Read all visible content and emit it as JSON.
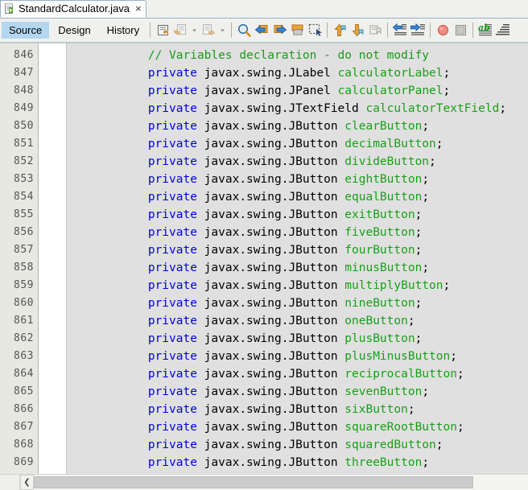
{
  "window": {
    "tab": {
      "title": "StandardCalculator.java",
      "close_label": "×",
      "icon": "java-file-icon"
    }
  },
  "view_tabs": [
    {
      "label": "Source",
      "active": true
    },
    {
      "label": "Design",
      "active": false
    },
    {
      "label": "History",
      "active": false
    }
  ],
  "toolbar": {
    "groups": [
      {
        "name": "navigation",
        "buttons": [
          {
            "name": "last-edit-back-button",
            "icon": "back-document-icon"
          },
          {
            "name": "last-edit-back-dropdown",
            "icon": "chevron-down-icon"
          },
          {
            "name": "last-edit-forward-button",
            "icon": "forward-document-icon"
          },
          {
            "name": "last-edit-forward-dropdown",
            "icon": "chevron-down-icon"
          }
        ]
      },
      {
        "name": "find",
        "buttons": [
          {
            "name": "find-selection-button",
            "icon": "magnifier-icon"
          },
          {
            "name": "find-previous-button",
            "icon": "arrow-left-find-icon"
          },
          {
            "name": "find-next-button",
            "icon": "arrow-right-find-icon"
          },
          {
            "name": "toggle-highlight-button",
            "icon": "highlight-rect-icon"
          },
          {
            "name": "toggle-rectangular-selection-button",
            "icon": "rect-select-icon"
          }
        ]
      },
      {
        "name": "bookmarks",
        "buttons": [
          {
            "name": "previous-bookmark-button",
            "icon": "arrow-up-bookmark-icon"
          },
          {
            "name": "next-bookmark-button",
            "icon": "arrow-down-bookmark-icon"
          },
          {
            "name": "toggle-bookmark-button",
            "icon": "toggle-bookmark-icon"
          }
        ]
      },
      {
        "name": "indent",
        "buttons": [
          {
            "name": "shift-left-button",
            "icon": "shift-left-icon"
          },
          {
            "name": "shift-right-button",
            "icon": "shift-right-icon"
          }
        ]
      },
      {
        "name": "debug",
        "buttons": [
          {
            "name": "toggle-breakpoint-button",
            "icon": "breakpoint-circle-icon"
          },
          {
            "name": "stop-button",
            "icon": "stop-square-icon"
          }
        ]
      },
      {
        "name": "format",
        "buttons": [
          {
            "name": "check-comments-button",
            "icon": "spellcheck-lines-icon"
          },
          {
            "name": "format-button",
            "icon": "format-lines-icon"
          }
        ]
      }
    ]
  },
  "editor": {
    "first_line_number": 846,
    "lines": [
      {
        "number": 846,
        "tokens": [
          {
            "t": "        ",
            "c": "pln"
          },
          {
            "t": "// Variables declaration - do not modify",
            "c": "cmt"
          }
        ]
      },
      {
        "number": 847,
        "tokens": [
          {
            "t": "        ",
            "c": "pln"
          },
          {
            "t": "private",
            "c": "kw"
          },
          {
            "t": " javax.swing.JLabel ",
            "c": "pln"
          },
          {
            "t": "calculatorLabel",
            "c": "fld"
          },
          {
            "t": ";",
            "c": "pln"
          }
        ]
      },
      {
        "number": 848,
        "tokens": [
          {
            "t": "        ",
            "c": "pln"
          },
          {
            "t": "private",
            "c": "kw"
          },
          {
            "t": " javax.swing.JPanel ",
            "c": "pln"
          },
          {
            "t": "calculatorPanel",
            "c": "fld"
          },
          {
            "t": ";",
            "c": "pln"
          }
        ]
      },
      {
        "number": 849,
        "tokens": [
          {
            "t": "        ",
            "c": "pln"
          },
          {
            "t": "private",
            "c": "kw"
          },
          {
            "t": " javax.swing.JTextField ",
            "c": "pln"
          },
          {
            "t": "calculatorTextField",
            "c": "fld"
          },
          {
            "t": ";",
            "c": "pln"
          }
        ]
      },
      {
        "number": 850,
        "tokens": [
          {
            "t": "        ",
            "c": "pln"
          },
          {
            "t": "private",
            "c": "kw"
          },
          {
            "t": " javax.swing.JButton ",
            "c": "pln"
          },
          {
            "t": "clearButton",
            "c": "fld"
          },
          {
            "t": ";",
            "c": "pln"
          }
        ]
      },
      {
        "number": 851,
        "tokens": [
          {
            "t": "        ",
            "c": "pln"
          },
          {
            "t": "private",
            "c": "kw"
          },
          {
            "t": " javax.swing.JButton ",
            "c": "pln"
          },
          {
            "t": "decimalButton",
            "c": "fld"
          },
          {
            "t": ";",
            "c": "pln"
          }
        ]
      },
      {
        "number": 852,
        "tokens": [
          {
            "t": "        ",
            "c": "pln"
          },
          {
            "t": "private",
            "c": "kw"
          },
          {
            "t": " javax.swing.JButton ",
            "c": "pln"
          },
          {
            "t": "divideButton",
            "c": "fld"
          },
          {
            "t": ";",
            "c": "pln"
          }
        ]
      },
      {
        "number": 853,
        "tokens": [
          {
            "t": "        ",
            "c": "pln"
          },
          {
            "t": "private",
            "c": "kw"
          },
          {
            "t": " javax.swing.JButton ",
            "c": "pln"
          },
          {
            "t": "eightButton",
            "c": "fld"
          },
          {
            "t": ";",
            "c": "pln"
          }
        ]
      },
      {
        "number": 854,
        "tokens": [
          {
            "t": "        ",
            "c": "pln"
          },
          {
            "t": "private",
            "c": "kw"
          },
          {
            "t": " javax.swing.JButton ",
            "c": "pln"
          },
          {
            "t": "equalButton",
            "c": "fld"
          },
          {
            "t": ";",
            "c": "pln"
          }
        ]
      },
      {
        "number": 855,
        "tokens": [
          {
            "t": "        ",
            "c": "pln"
          },
          {
            "t": "private",
            "c": "kw"
          },
          {
            "t": " javax.swing.JButton ",
            "c": "pln"
          },
          {
            "t": "exitButton",
            "c": "fld"
          },
          {
            "t": ";",
            "c": "pln"
          }
        ]
      },
      {
        "number": 856,
        "tokens": [
          {
            "t": "        ",
            "c": "pln"
          },
          {
            "t": "private",
            "c": "kw"
          },
          {
            "t": " javax.swing.JButton ",
            "c": "pln"
          },
          {
            "t": "fiveButton",
            "c": "fld"
          },
          {
            "t": ";",
            "c": "pln"
          }
        ]
      },
      {
        "number": 857,
        "tokens": [
          {
            "t": "        ",
            "c": "pln"
          },
          {
            "t": "private",
            "c": "kw"
          },
          {
            "t": " javax.swing.JButton ",
            "c": "pln"
          },
          {
            "t": "fourButton",
            "c": "fld"
          },
          {
            "t": ";",
            "c": "pln"
          }
        ]
      },
      {
        "number": 858,
        "tokens": [
          {
            "t": "        ",
            "c": "pln"
          },
          {
            "t": "private",
            "c": "kw"
          },
          {
            "t": " javax.swing.JButton ",
            "c": "pln"
          },
          {
            "t": "minusButton",
            "c": "fld"
          },
          {
            "t": ";",
            "c": "pln"
          }
        ]
      },
      {
        "number": 859,
        "tokens": [
          {
            "t": "        ",
            "c": "pln"
          },
          {
            "t": "private",
            "c": "kw"
          },
          {
            "t": " javax.swing.JButton ",
            "c": "pln"
          },
          {
            "t": "multiplyButton",
            "c": "fld"
          },
          {
            "t": ";",
            "c": "pln"
          }
        ]
      },
      {
        "number": 860,
        "tokens": [
          {
            "t": "        ",
            "c": "pln"
          },
          {
            "t": "private",
            "c": "kw"
          },
          {
            "t": " javax.swing.JButton ",
            "c": "pln"
          },
          {
            "t": "nineButton",
            "c": "fld"
          },
          {
            "t": ";",
            "c": "pln"
          }
        ]
      },
      {
        "number": 861,
        "tokens": [
          {
            "t": "        ",
            "c": "pln"
          },
          {
            "t": "private",
            "c": "kw"
          },
          {
            "t": " javax.swing.JButton ",
            "c": "pln"
          },
          {
            "t": "oneButton",
            "c": "fld"
          },
          {
            "t": ";",
            "c": "pln"
          }
        ]
      },
      {
        "number": 862,
        "tokens": [
          {
            "t": "        ",
            "c": "pln"
          },
          {
            "t": "private",
            "c": "kw"
          },
          {
            "t": " javax.swing.JButton ",
            "c": "pln"
          },
          {
            "t": "plusButton",
            "c": "fld"
          },
          {
            "t": ";",
            "c": "pln"
          }
        ]
      },
      {
        "number": 863,
        "tokens": [
          {
            "t": "        ",
            "c": "pln"
          },
          {
            "t": "private",
            "c": "kw"
          },
          {
            "t": " javax.swing.JButton ",
            "c": "pln"
          },
          {
            "t": "plusMinusButton",
            "c": "fld"
          },
          {
            "t": ";",
            "c": "pln"
          }
        ]
      },
      {
        "number": 864,
        "tokens": [
          {
            "t": "        ",
            "c": "pln"
          },
          {
            "t": "private",
            "c": "kw"
          },
          {
            "t": " javax.swing.JButton ",
            "c": "pln"
          },
          {
            "t": "reciprocalButton",
            "c": "fld"
          },
          {
            "t": ";",
            "c": "pln"
          }
        ]
      },
      {
        "number": 865,
        "tokens": [
          {
            "t": "        ",
            "c": "pln"
          },
          {
            "t": "private",
            "c": "kw"
          },
          {
            "t": " javax.swing.JButton ",
            "c": "pln"
          },
          {
            "t": "sevenButton",
            "c": "fld"
          },
          {
            "t": ";",
            "c": "pln"
          }
        ]
      },
      {
        "number": 866,
        "tokens": [
          {
            "t": "        ",
            "c": "pln"
          },
          {
            "t": "private",
            "c": "kw"
          },
          {
            "t": " javax.swing.JButton ",
            "c": "pln"
          },
          {
            "t": "sixButton",
            "c": "fld"
          },
          {
            "t": ";",
            "c": "pln"
          }
        ]
      },
      {
        "number": 867,
        "tokens": [
          {
            "t": "        ",
            "c": "pln"
          },
          {
            "t": "private",
            "c": "kw"
          },
          {
            "t": " javax.swing.JButton ",
            "c": "pln"
          },
          {
            "t": "squareRootButton",
            "c": "fld"
          },
          {
            "t": ";",
            "c": "pln"
          }
        ]
      },
      {
        "number": 868,
        "tokens": [
          {
            "t": "        ",
            "c": "pln"
          },
          {
            "t": "private",
            "c": "kw"
          },
          {
            "t": " javax.swing.JButton ",
            "c": "pln"
          },
          {
            "t": "squaredButton",
            "c": "fld"
          },
          {
            "t": ";",
            "c": "pln"
          }
        ]
      },
      {
        "number": 869,
        "tokens": [
          {
            "t": "        ",
            "c": "pln"
          },
          {
            "t": "private",
            "c": "kw"
          },
          {
            "t": " javax.swing.JButton ",
            "c": "pln"
          },
          {
            "t": "threeButton",
            "c": "fld"
          },
          {
            "t": ";",
            "c": "pln"
          }
        ]
      }
    ]
  },
  "scrollbar": {
    "left_arrow_label": "❮",
    "thumb_width_percent": 89
  },
  "colors": {
    "keyword": "#0000e6",
    "comment": "#1a9a1a",
    "field": "#17a117",
    "guarded_block_background": "#e0e0e0",
    "gutter_background": "#e8e8e2",
    "active_tab_highlight": "#b3d7f0",
    "chrome_background": "#f0f0ee"
  }
}
